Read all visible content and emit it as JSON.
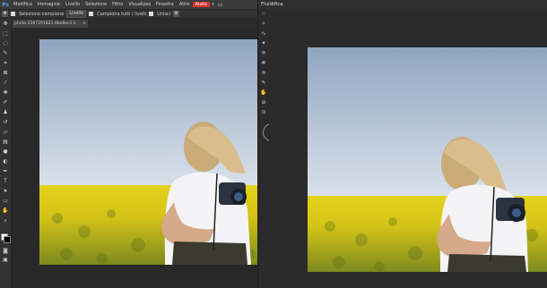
{
  "app": {
    "logo": "Ps",
    "menu": [
      "Modifica",
      "Immagine",
      "Livello",
      "Selezione",
      "Filtro",
      "Visualizza",
      "Finestra",
      "Altro",
      "Aiuto"
    ],
    "active_menu": "Aiuto",
    "right_icons": [
      "search-icon",
      "window-icon"
    ]
  },
  "options": {
    "sample_label": "Selezione campione",
    "sample_value": "Livello",
    "check1_label": "Campiona tutti i livelli",
    "check2_label": "Unisci"
  },
  "document": {
    "tab_label": "photo-1567291821-4be8ec2:1",
    "close": "×"
  },
  "tools": [
    "move-icon",
    "marquee-icon",
    "lasso-icon",
    "quick-select-icon",
    "crop-icon",
    "frame-icon",
    "eyedropper-icon",
    "healing-icon",
    "brush-icon",
    "stamp-icon",
    "history-brush-icon",
    "eraser-icon",
    "gradient-icon",
    "blur-icon",
    "dodge-icon",
    "pen-icon",
    "type-icon",
    "path-select-icon",
    "shape-icon",
    "hand-icon",
    "zoom-icon"
  ],
  "liquify": {
    "title": "Fluidifica",
    "tools": [
      "forward-warp-icon",
      "reconstruct-icon",
      "smooth-icon",
      "twirl-icon",
      "pucker-icon",
      "bloat-icon",
      "push-left-icon",
      "freeze-mask-icon",
      "thaw-mask-icon",
      "face-tool-icon",
      "hand-icon",
      "zoom-icon"
    ]
  },
  "colors": {
    "accent": "#d7352b",
    "foreground": "#ffffff",
    "background": "#000000"
  }
}
